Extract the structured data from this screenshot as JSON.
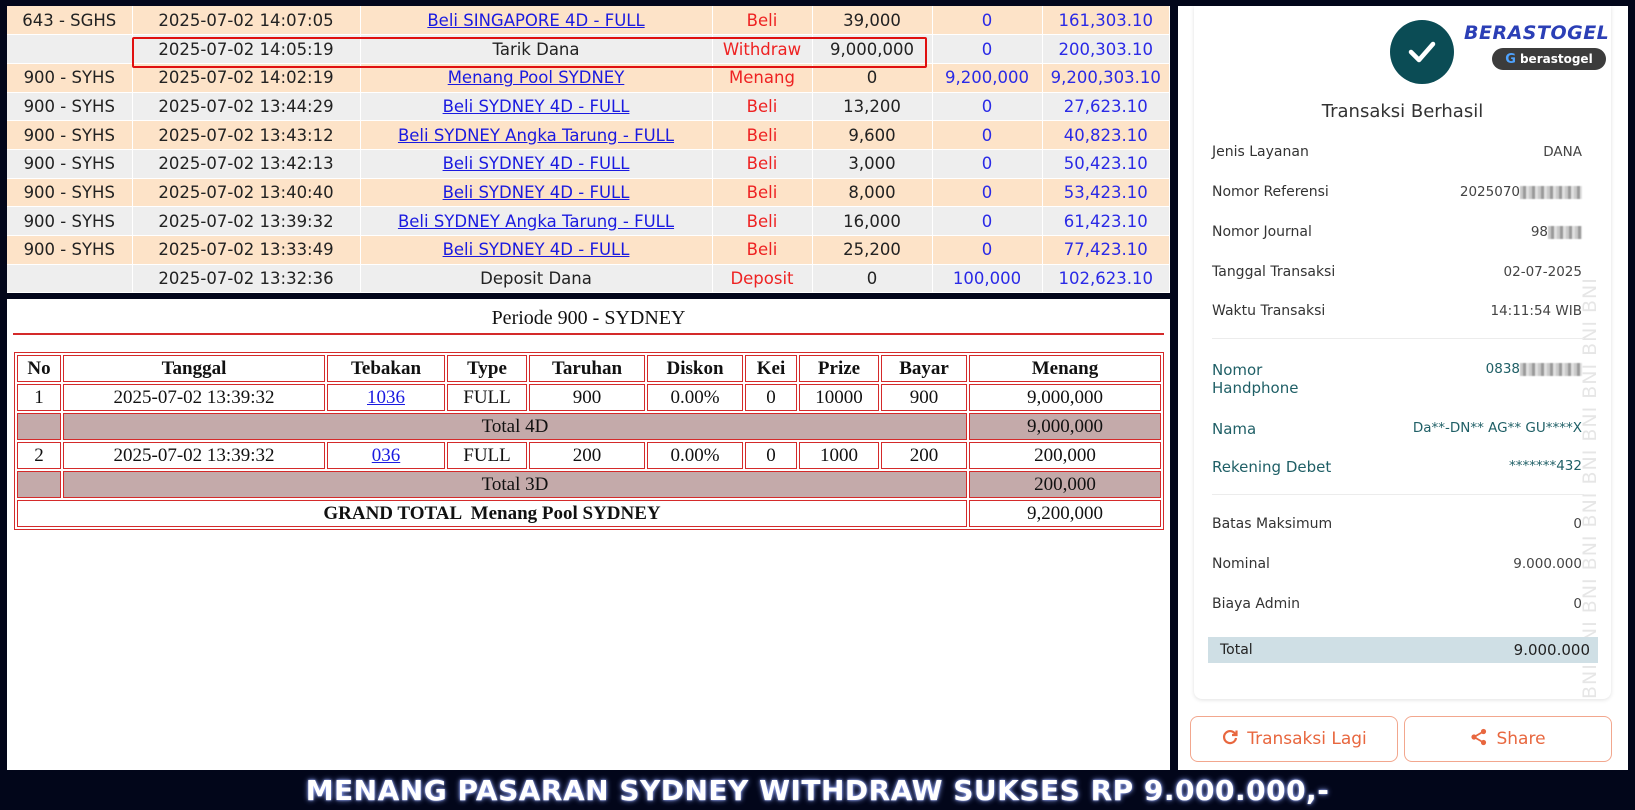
{
  "transactions": [
    {
      "market": "643 - SGHS",
      "datetime": "2025-07-02 14:07:05",
      "description": "Beli SINGAPORE 4D - FULL",
      "link": true,
      "type": "Beli",
      "amount": "39,000",
      "credit": "0",
      "balance": "161,303.10"
    },
    {
      "market": "",
      "datetime": "2025-07-02 14:05:19",
      "description": "Tarik Dana",
      "link": false,
      "type": "Withdraw",
      "amount": "9,000,000",
      "credit": "0",
      "balance": "200,303.10"
    },
    {
      "market": "900 - SYHS",
      "datetime": "2025-07-02 14:02:19",
      "description": "Menang Pool SYDNEY",
      "link": true,
      "type": "Menang",
      "amount": "0",
      "credit": "9,200,000",
      "balance": "9,200,303.10"
    },
    {
      "market": "900 - SYHS",
      "datetime": "2025-07-02 13:44:29",
      "description": "Beli SYDNEY 4D - FULL",
      "link": true,
      "type": "Beli",
      "amount": "13,200",
      "credit": "0",
      "balance": "27,623.10"
    },
    {
      "market": "900 - SYHS",
      "datetime": "2025-07-02 13:43:12",
      "description": "Beli SYDNEY Angka Tarung - FULL",
      "link": true,
      "type": "Beli",
      "amount": "9,600",
      "credit": "0",
      "balance": "40,823.10"
    },
    {
      "market": "900 - SYHS",
      "datetime": "2025-07-02 13:42:13",
      "description": "Beli SYDNEY 4D - FULL",
      "link": true,
      "type": "Beli",
      "amount": "3,000",
      "credit": "0",
      "balance": "50,423.10"
    },
    {
      "market": "900 - SYHS",
      "datetime": "2025-07-02 13:40:40",
      "description": "Beli SYDNEY 4D - FULL",
      "link": true,
      "type": "Beli",
      "amount": "8,000",
      "credit": "0",
      "balance": "53,423.10"
    },
    {
      "market": "900 - SYHS",
      "datetime": "2025-07-02 13:39:32",
      "description": "Beli SYDNEY Angka Tarung - FULL",
      "link": true,
      "type": "Beli",
      "amount": "16,000",
      "credit": "0",
      "balance": "61,423.10"
    },
    {
      "market": "900 - SYHS",
      "datetime": "2025-07-02 13:33:49",
      "description": "Beli SYDNEY 4D - FULL",
      "link": true,
      "type": "Beli",
      "amount": "25,200",
      "credit": "0",
      "balance": "77,423.10"
    },
    {
      "market": "",
      "datetime": "2025-07-02 13:32:36",
      "description": "Deposit Dana",
      "link": false,
      "type": "Deposit",
      "amount": "0",
      "credit": "100,000",
      "balance": "102,623.10"
    }
  ],
  "period": {
    "title": "Periode 900 - SYDNEY",
    "headers": [
      "No",
      "Tanggal",
      "Tebakan",
      "Type",
      "Taruhan",
      "Diskon",
      "Kei",
      "Prize",
      "Bayar",
      "Menang"
    ],
    "rows": [
      {
        "no": "1",
        "tanggal": "2025-07-02 13:39:32",
        "tebakan": "1036",
        "type": "FULL",
        "taruhan": "900",
        "diskon": "0.00%",
        "kei": "0",
        "prize": "10000",
        "bayar": "900",
        "menang": "9,000,000"
      },
      {
        "no": "2",
        "tanggal": "2025-07-02 13:39:32",
        "tebakan": "036",
        "type": "FULL",
        "taruhan": "200",
        "diskon": "0.00%",
        "kei": "0",
        "prize": "1000",
        "bayar": "200",
        "menang": "200,000"
      }
    ],
    "totals": [
      {
        "label": "Total 4D",
        "value": "9,000,000"
      },
      {
        "label": "Total 3D",
        "value": "200,000"
      }
    ],
    "grand_total": {
      "label": "GRAND TOTAL  Menang Pool SYDNEY",
      "value": "9,200,000"
    }
  },
  "receipt": {
    "brand": "BERASTOGEL",
    "brand_pill": "berastogel",
    "watermark": "BNI BNI BNI BNI BNI BNI BNI BNI BNI BNI",
    "title": "Transaksi Berhasil",
    "fields": {
      "jenis_layanan": {
        "label": "Jenis Layanan",
        "value": "DANA"
      },
      "nomor_referensi": {
        "label": "Nomor Referensi",
        "value": "2025070"
      },
      "nomor_journal": {
        "label": "Nomor Journal",
        "value": "98"
      },
      "tanggal_transaksi": {
        "label": "Tanggal Transaksi",
        "value": "02-07-2025"
      },
      "waktu_transaksi": {
        "label": "Waktu Transaksi",
        "value": "14:11:54 WIB"
      },
      "nomor_handphone": {
        "label": "Nomor Handphone",
        "value": "0838"
      },
      "nama": {
        "label": "Nama",
        "value": "Da**-DN** AG** GU****X"
      },
      "rekening_debet": {
        "label": "Rekening Debet",
        "value": "*******432"
      },
      "batas_maksimum": {
        "label": "Batas Maksimum",
        "value": "0"
      },
      "nominal": {
        "label": "Nominal",
        "value": "9.000.000"
      },
      "biaya_admin": {
        "label": "Biaya Admin",
        "value": "0"
      }
    },
    "total": {
      "label": "Total",
      "value": "9.000.000"
    },
    "buttons": {
      "again": "Transaksi Lagi",
      "share": "Share"
    },
    "colors": {
      "accent": "#e8673f",
      "teal": "#0b4c55",
      "total_bar": "#cfdfe5"
    }
  },
  "banner": "MENANG PASARAN SYDNEY WITHDRAW SUKSES RP 9.000.000,-",
  "colors": {
    "row_odd": "#fde3c8",
    "row_even": "#eeeeee",
    "red": "#ee2222",
    "blue": "#2a2ae6",
    "background": "#02061a"
  }
}
